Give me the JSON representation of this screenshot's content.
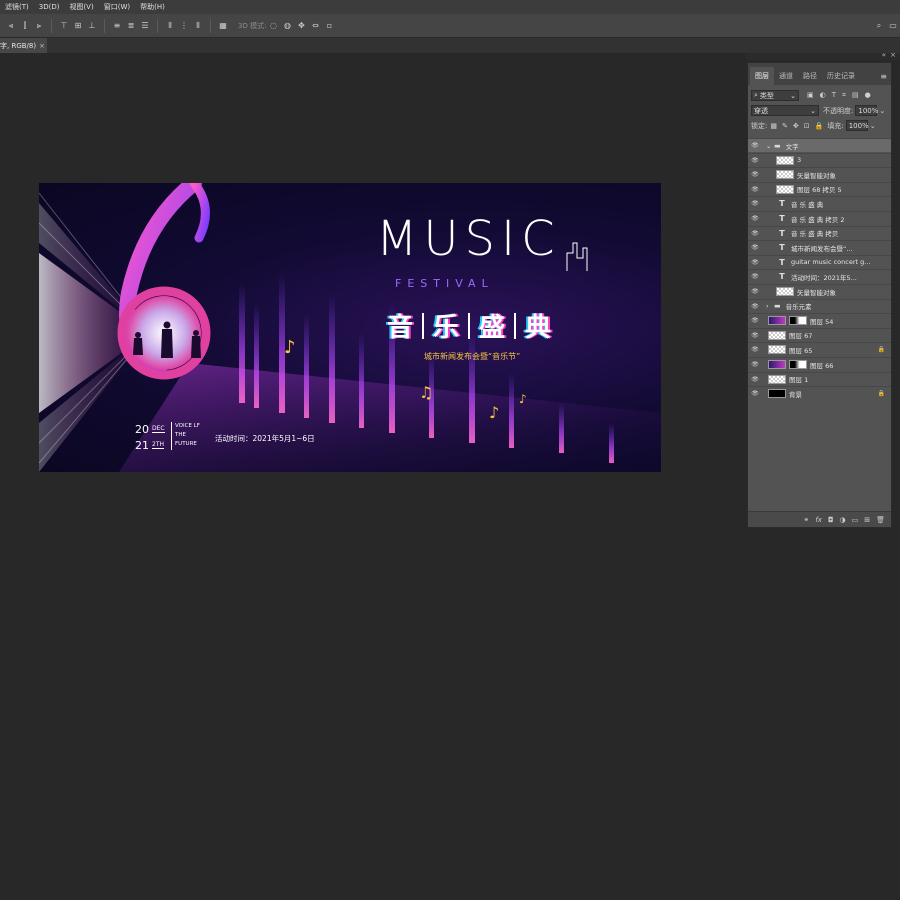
{
  "menu": [
    "滤镜(T)",
    "3D(D)",
    "视图(V)",
    "窗口(W)",
    "帮助(H)"
  ],
  "optbar": {
    "mode3d": "3D 模式:"
  },
  "doc_tab": {
    "title": "字, RGB/8)",
    "close": "×"
  },
  "artwork": {
    "music_title": "MUSIC",
    "festival": "FESTIVAL",
    "chinese_title": [
      "音",
      "乐",
      "盛",
      "典"
    ],
    "subtitle": "城市新闻发布会暨“音乐节”",
    "date_day1": "20",
    "date_month1": "DEC",
    "date_day2": "21",
    "date_month2": "2TH",
    "voice_lines": [
      "VOICE LF",
      "THE",
      "FUTURE"
    ],
    "activity_time": "活动时间：2021年5月1~6日",
    "colors": {
      "pink": "#e040a0",
      "purple": "#7b3cff",
      "gold": "#f5c542",
      "blue": "#2b62ff"
    }
  },
  "layers_panel": {
    "tabs": [
      "图层",
      "通道",
      "路径",
      "历史记录"
    ],
    "filter_type": "类型",
    "blend_mode": "穿透",
    "opacity_label": "不透明度:",
    "opacity": "100%",
    "lock_label": "锁定:",
    "fill_label": "填充:",
    "fill": "100%",
    "layers": [
      {
        "name": "文字",
        "kind": "group",
        "active": true
      },
      {
        "name": "3",
        "kind": "image"
      },
      {
        "name": "矢量智能对象",
        "kind": "smart"
      },
      {
        "name": "图层 68 拷贝 5",
        "kind": "image"
      },
      {
        "name": "音 乐 盛 典",
        "kind": "text"
      },
      {
        "name": "音 乐 盛 典 拷贝 2",
        "kind": "text"
      },
      {
        "name": "音 乐 盛 典 拷贝",
        "kind": "text"
      },
      {
        "name": "城市新闻发布会暨“...",
        "kind": "text"
      },
      {
        "name": "guitar music concert g...",
        "kind": "text"
      },
      {
        "name": "活动时间：2021年5...",
        "kind": "text"
      },
      {
        "name": "矢量智能对象",
        "kind": "smart"
      },
      {
        "name": "音乐元素",
        "kind": "group"
      },
      {
        "name": "图层 54",
        "kind": "masked"
      },
      {
        "name": "图层 67",
        "kind": "image"
      },
      {
        "name": "图层 65",
        "kind": "image",
        "locked": true
      },
      {
        "name": "图层 66",
        "kind": "masked"
      },
      {
        "name": "图层 1",
        "kind": "image"
      },
      {
        "name": "背景",
        "kind": "background",
        "locked": true
      }
    ]
  }
}
